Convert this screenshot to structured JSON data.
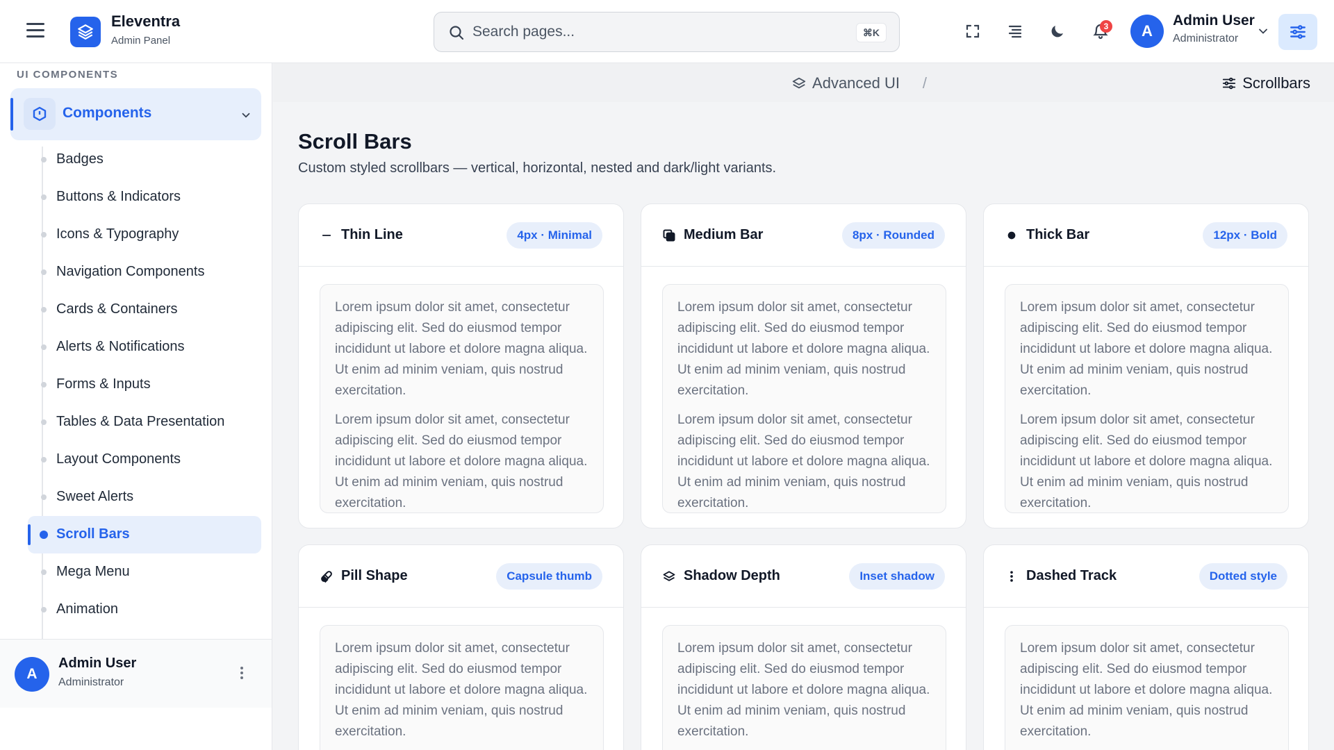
{
  "brand": {
    "name": "Eleventra",
    "subtitle": "Admin Panel",
    "accent": "#2563eb"
  },
  "search": {
    "placeholder": "Search pages...",
    "shortcut": "⌘K"
  },
  "header": {
    "icons": [
      "fullscreen-icon",
      "align-icon",
      "moon-icon",
      "bell-icon",
      "sliders-icon"
    ],
    "notification_count": "3",
    "user": {
      "initial": "A",
      "name": "Admin User",
      "role": "Administrator"
    }
  },
  "sidebar": {
    "section_label": "UI COMPONENTS",
    "group": {
      "label": "Components",
      "icon": "components-icon"
    },
    "items": [
      {
        "label": "Badges"
      },
      {
        "label": "Buttons & Indicators"
      },
      {
        "label": "Icons & Typography"
      },
      {
        "label": "Navigation Components"
      },
      {
        "label": "Cards & Containers"
      },
      {
        "label": "Alerts & Notifications"
      },
      {
        "label": "Forms & Inputs"
      },
      {
        "label": "Tables & Data Presentation"
      },
      {
        "label": "Layout Components"
      },
      {
        "label": "Sweet Alerts"
      },
      {
        "label": "Scroll Bars",
        "active": true
      },
      {
        "label": "Mega Menu"
      },
      {
        "label": "Animation"
      }
    ],
    "footer": {
      "initial": "A",
      "name": "Admin User",
      "role": "Administrator"
    }
  },
  "breadcrumb": {
    "parent": "Advanced UI",
    "separator": "/",
    "current": "Scrollbars"
  },
  "page": {
    "title": "Scroll Bars",
    "description": "Custom styled scrollbars — vertical, horizontal, nested and dark/light variants."
  },
  "cards": [
    {
      "title": "Thin Line",
      "badge": "4px · Minimal",
      "icon": "dash-icon"
    },
    {
      "title": "Medium Bar",
      "badge": "8px · Rounded",
      "icon": "copy-icon"
    },
    {
      "title": "Thick Bar",
      "badge": "12px · Bold",
      "icon": "circle-icon"
    },
    {
      "title": "Pill Shape",
      "badge": "Capsule thumb",
      "icon": "pill-icon"
    },
    {
      "title": "Shadow Depth",
      "badge": "Inset shadow",
      "icon": "layers-icon"
    },
    {
      "title": "Dashed Track",
      "badge": "Dotted style",
      "icon": "dots-vertical-icon"
    }
  ],
  "lorem": "Lorem ipsum dolor sit amet, consectetur adipiscing elit. Sed do eiusmod tempor incididunt ut labore et dolore magna aliqua. Ut enim ad minim veniam, quis nostrud exercitation."
}
